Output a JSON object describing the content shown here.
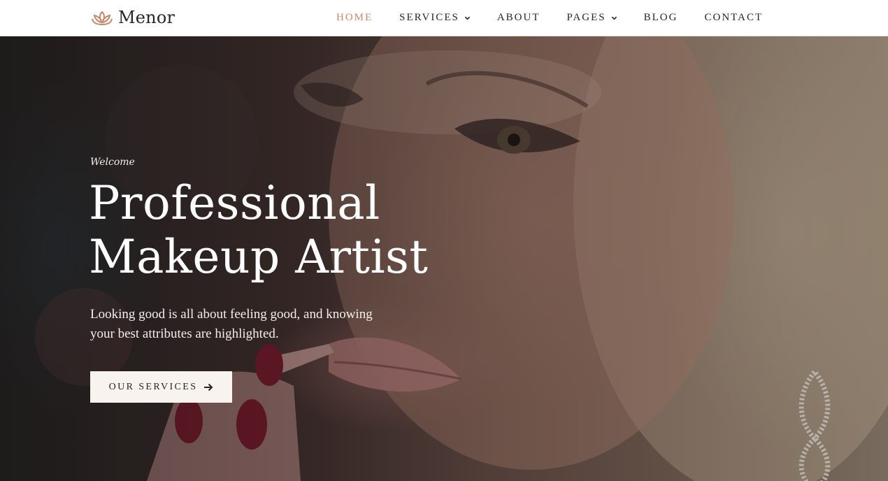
{
  "brand": {
    "name": "Menor",
    "logo_icon": "lotus-icon",
    "accent": "#c9866a"
  },
  "nav": {
    "items": [
      {
        "label": "HOME",
        "active": true,
        "has_dropdown": false
      },
      {
        "label": "SERVICES",
        "active": false,
        "has_dropdown": true
      },
      {
        "label": "ABOUT",
        "active": false,
        "has_dropdown": false
      },
      {
        "label": "PAGES",
        "active": false,
        "has_dropdown": true
      },
      {
        "label": "BLOG",
        "active": false,
        "has_dropdown": false
      },
      {
        "label": "CONTACT",
        "active": false,
        "has_dropdown": false
      }
    ]
  },
  "hero": {
    "eyebrow": "Welcome",
    "title_line1": "Professional",
    "title_line2": "Makeup Artist",
    "description": "Looking good is all about feeling good, and knowing your best attributes are highlighted.",
    "cta_label": "OUR SERVICES",
    "cta_icon": "arrow-right-icon"
  }
}
